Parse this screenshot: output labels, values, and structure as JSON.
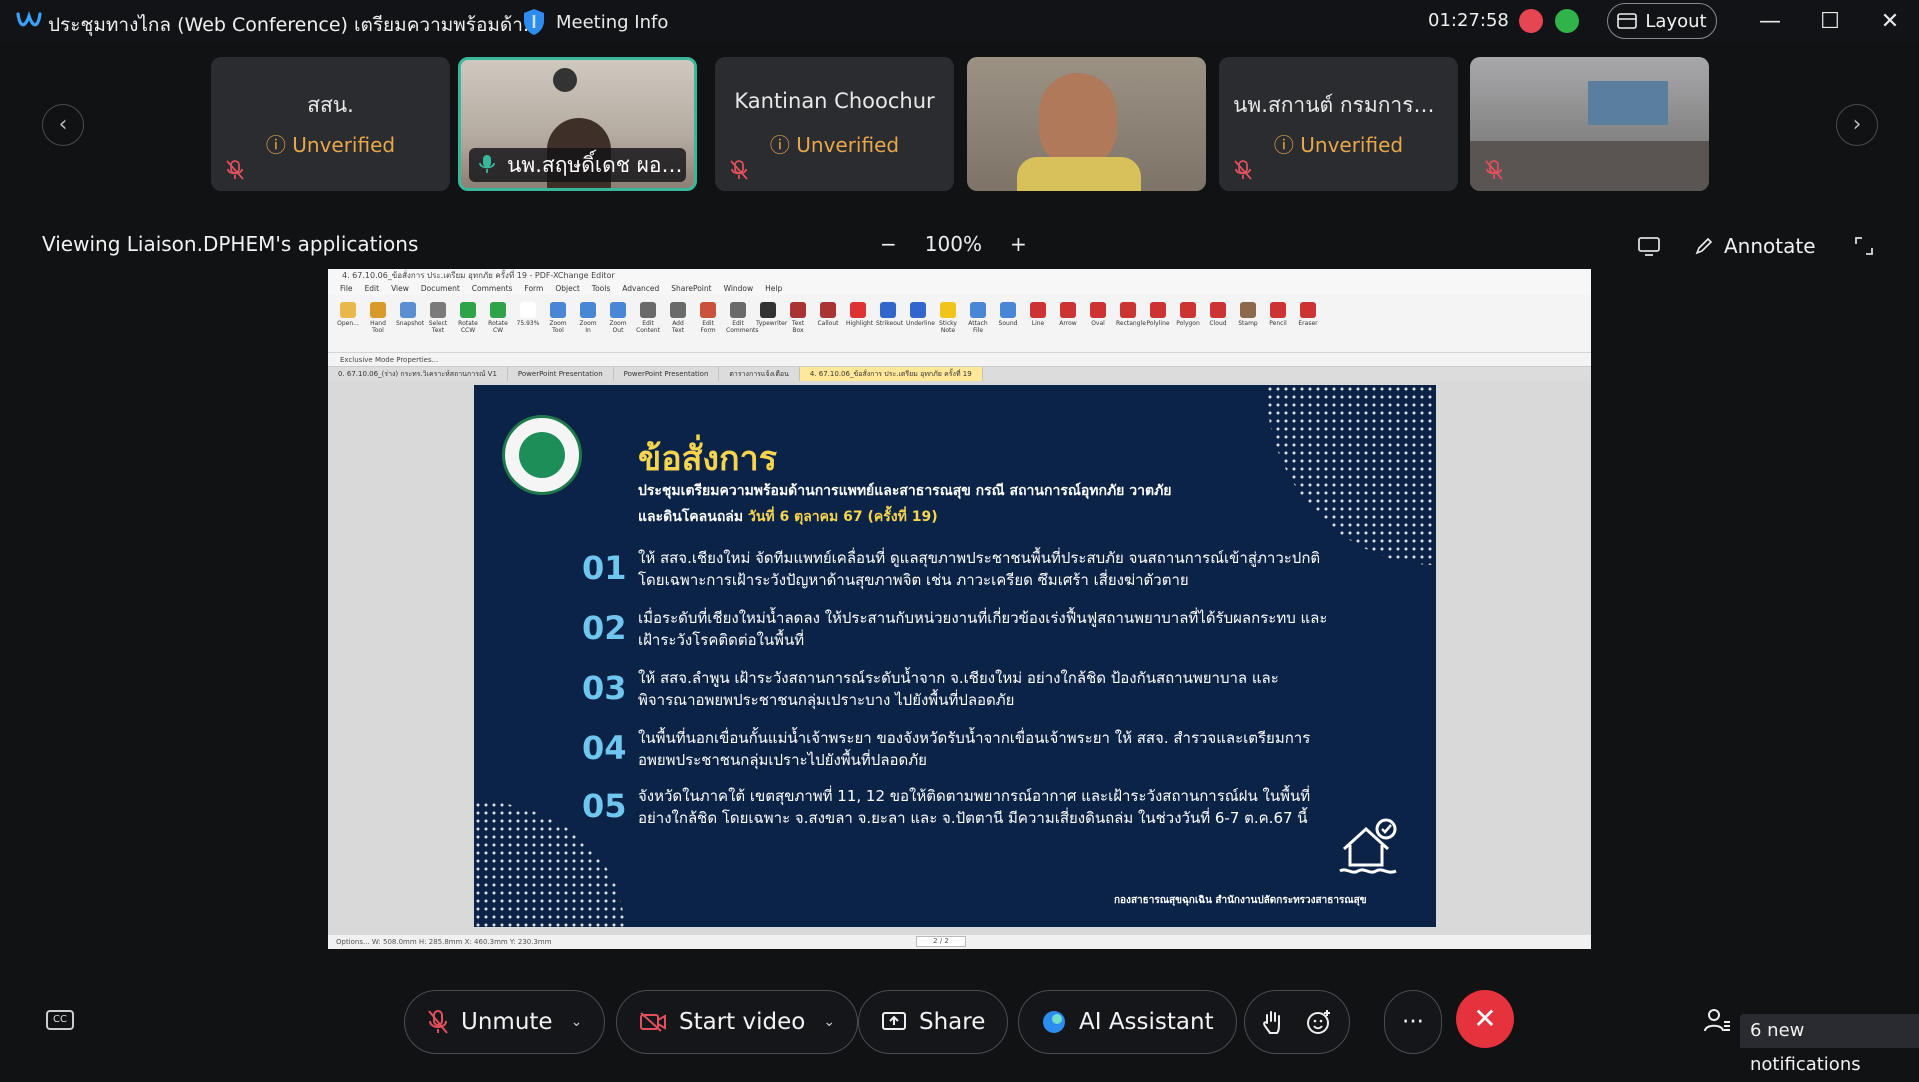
{
  "window": {
    "title": "ประชุมทางไกล (Web Conference) เตรียมความพร้อมด้า...",
    "meeting_info_label": "Meeting Info",
    "clock": "01:27:58",
    "layout_label": "Layout"
  },
  "participants": [
    {
      "name": "สสน.",
      "status": "Unverified",
      "muted": true,
      "video": false
    },
    {
      "name": "นพ.สฤษดิ์เดช ผอ.ก...",
      "status": "",
      "muted": false,
      "video": true,
      "active_speaker": true
    },
    {
      "name": "Kantinan Choochur",
      "status": "Unverified",
      "muted": true,
      "video": false
    },
    {
      "name": "",
      "status": "",
      "muted": false,
      "video": true
    },
    {
      "name": "นพ.สกานต์ กรมการแพ...",
      "status": "Unverified",
      "muted": true,
      "video": false
    },
    {
      "name": "",
      "status": "",
      "muted": true,
      "video": true
    }
  ],
  "share": {
    "viewing_text": "Viewing Liaison.DPHEM's applications",
    "zoom_minus": "−",
    "zoom_level": "100%",
    "zoom_plus": "+",
    "annotate_label": "Annotate"
  },
  "pdf_editor": {
    "title": "4. 67.10.06_ข้อสั่งการ ประ.เตรียม อุทกภัย ครั้งที่ 19 - PDF-XChange Editor",
    "menu": [
      "File",
      "Edit",
      "View",
      "Document",
      "Comments",
      "Form",
      "Object",
      "Tools",
      "Advanced",
      "SharePoint",
      "Window",
      "Help"
    ],
    "ribbon": [
      "Open...",
      "Hand Tool",
      "Snapshot",
      "Select Text",
      "Rotate CCW",
      "Rotate CW",
      "75.93%",
      "Zoom Tool",
      "Zoom In",
      "Zoom Out",
      "Edit Content",
      "Add Text",
      "Edit Form",
      "Edit Comments",
      "Typewriter",
      "Text Box",
      "Callout",
      "Highlight",
      "Strikeout",
      "Underline",
      "Sticky Note",
      "Attach File",
      "Sound",
      "Line",
      "Arrow",
      "Oval",
      "Rectangle",
      "Polyline",
      "Polygon",
      "Cloud",
      "Stamp",
      "Pencil",
      "Eraser"
    ],
    "mode_bar": "Exclusive Mode   Properties...",
    "tabs": [
      "0. 67.10.06_(ร่าง) กระทร.วิเคราะห์สถานการณ์ V1",
      "PowerPoint Presentation",
      "PowerPoint Presentation",
      "ตารางการแจ้งเตือน",
      "4. 67.10.06_ข้อสั่งการ ประ.เตรียม อุทกภัย ครั้งที่ 19"
    ],
    "status": "Options...   W: 508.0mm  H: 285.8mm   X: 460.3mm  Y: 230.3mm",
    "page_indicator": "2 / 2"
  },
  "slide": {
    "title": "ข้อสั่งการ",
    "subtitle_line1": "ประชุมเตรียมความพร้อมด้านการแพทย์และสาธารณสุข กรณี สถานการณ์อุทกภัย วาตภัย",
    "subtitle_line2": "และดินโคลนถล่ม ",
    "subtitle_date": "วันที่ 6 ตุลาคม 67 (ครั้งที่ 19)",
    "items": [
      {
        "num": "01",
        "text": "ให้ สสจ.เชียงใหม่ จัดทีมแพทย์เคลื่อนที่ ดูแลสุขภาพประชาชนพื้นที่ประสบภัย จนสถานการณ์เข้าสู่ภาวะปกติ โดยเฉพาะการเฝ้าระวังปัญหาด้านสุขภาพจิต เช่น ภาวะเครียด ซึมเศร้า เสี่ยงฆ่าตัวตาย"
      },
      {
        "num": "02",
        "text": "เมื่อระดับที่เชียงใหม่น้ำลดลง ให้ประสานกับหน่วยงานที่เกี่ยวข้องเร่งฟื้นฟูสถานพยาบาลที่ได้รับผลกระทบ และเฝ้าระวังโรคติดต่อในพื้นที่"
      },
      {
        "num": "03",
        "text": "ให้ สสจ.ลำพูน เฝ้าระวังสถานการณ์ระดับน้ำจาก จ.เชียงใหม่ อย่างใกล้ชิด ป้องกันสถานพยาบาล และพิจารณาอพยพประชาชนกลุ่มเปราะบาง ไปยังพื้นที่ปลอดภัย"
      },
      {
        "num": "04",
        "text": "ในพื้นที่นอกเขื่อนกั้นแม่น้ำเจ้าพระยา ของจังหวัดรับน้ำจากเขื่อนเจ้าพระยา ให้ สสจ. สำรวจและเตรียมการอพยพประชาชนกลุ่มเปราะไปยังพื้นที่ปลอดภัย"
      },
      {
        "num": "05",
        "text": "จังหวัดในภาคใต้ เขตสุขภาพที่ 11, 12 ขอให้ติดตามพยากรณ์อากาศ และเฝ้าระวังสถานการณ์ฝน ในพื้นที่อย่างใกล้ชิด โดยเฉพาะ จ.สงขลา จ.ยะลา และ จ.ปัตตานี มีความเสี่ยงดินถล่ม ในช่วงวันที่ 6-7 ต.ค.67 นี้"
      }
    ],
    "footer": "กองสาธารณสุขฉุกเฉิน สำนักงานปลัดกระทรวงสาธารณสุข"
  },
  "toolbar": {
    "unmute_label": "Unmute",
    "start_video_label": "Start video",
    "share_label": "Share",
    "ai_label": "AI Assistant",
    "more_label": "···",
    "leave_label": "✕",
    "cc_label": "CC",
    "notifications": "6 new notifications"
  },
  "colors": {
    "accent_teal": "#39b79b",
    "unverified": "#e8a74a",
    "leave_red": "#e6323d",
    "slide_bg": "#0b2347",
    "slide_yellow": "#f7d44e",
    "slide_number": "#6fc6ef"
  }
}
